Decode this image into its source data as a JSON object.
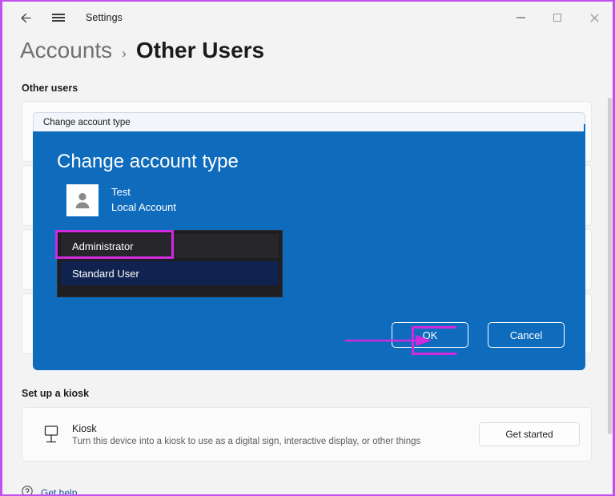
{
  "window": {
    "app_title": "Settings",
    "back_icon": "back-arrow-icon",
    "menu_icon": "hamburger-menu-icon",
    "minimize_icon": "minimize-icon",
    "maximize_icon": "maximize-icon",
    "close_icon": "close-icon",
    "accent_highlight_color": "#c24ff0"
  },
  "breadcrumb": {
    "parent": "Accounts",
    "separator": "›",
    "current": "Other Users"
  },
  "sections": {
    "other_users_heading": "Other users",
    "kiosk_heading": "Set up a kiosk"
  },
  "kiosk": {
    "icon": "kiosk-sign-icon",
    "title": "Kiosk",
    "description": "Turn this device into a kiosk to use as a digital sign, interactive display, or other things",
    "button_label": "Get started"
  },
  "footer": {
    "help_icon": "help-question-icon",
    "help_label": "Get help"
  },
  "dialog": {
    "titlebar_label": "Change account type",
    "heading": "Change account type",
    "background_color": "#0f6cbd",
    "avatar_icon": "user-avatar-icon",
    "user": {
      "name": "Test",
      "account_type": "Local Account"
    },
    "dropdown": {
      "options": [
        {
          "label": "Administrator",
          "state": "highlighted"
        },
        {
          "label": "Standard User",
          "state": "selected"
        }
      ]
    },
    "buttons": {
      "ok_label": "OK",
      "cancel_label": "Cancel"
    }
  },
  "annotations": {
    "color": "#cf2ae0",
    "arrow_target": "ok-button",
    "box_target": "administrator-option"
  }
}
